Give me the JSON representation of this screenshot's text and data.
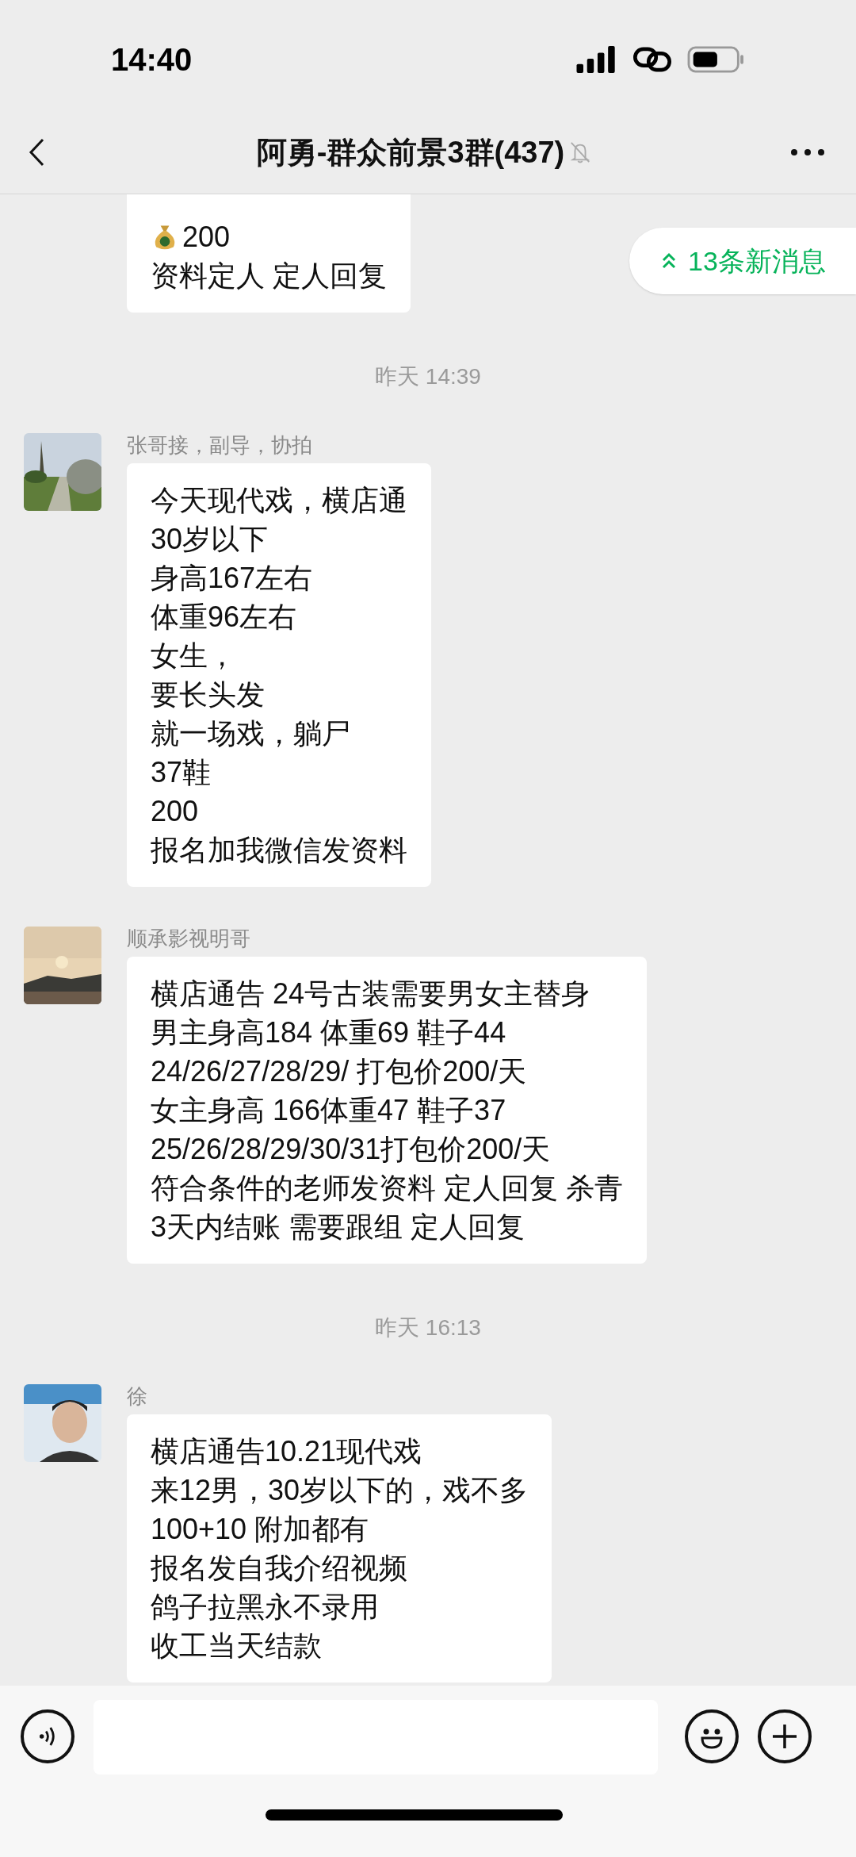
{
  "status_bar": {
    "time": "14:40"
  },
  "header": {
    "title": "阿勇-群众前景3群(437)",
    "muted": true
  },
  "new_messages": {
    "label": "13条新消息"
  },
  "feed": [
    {
      "kind": "message",
      "lines": [
        {
          "kind": "money",
          "text": "200"
        },
        {
          "kind": "text",
          "text": "资料定人  定人回复"
        }
      ]
    },
    {
      "kind": "timestamp",
      "text": "昨天 14:39"
    },
    {
      "kind": "message",
      "sender": "张哥接，副导，协拍",
      "lines": [
        {
          "kind": "text",
          "text": "今天现代戏，横店通"
        },
        {
          "kind": "text",
          "text": "30岁以下"
        },
        {
          "kind": "text",
          "text": "身高167左右"
        },
        {
          "kind": "text",
          "text": "体重96左右"
        },
        {
          "kind": "text",
          "text": "女生，"
        },
        {
          "kind": "text",
          "text": "要长头发"
        },
        {
          "kind": "text",
          "text": "就一场戏，躺尸"
        },
        {
          "kind": "text",
          "text": "37鞋"
        },
        {
          "kind": "text",
          "text": "200"
        },
        {
          "kind": "text",
          "text": "报名加我微信发资料"
        }
      ]
    },
    {
      "kind": "message",
      "sender": "顺承影视明哥",
      "lines": [
        {
          "kind": "text",
          "text": "横店通告 24号古装需要男女主替身"
        },
        {
          "kind": "text",
          "text": "男主身高184 体重69  鞋子44"
        },
        {
          "kind": "text",
          "text": "24/26/27/28/29/ 打包价200/天"
        },
        {
          "kind": "text",
          "text": "女主身高 166体重47  鞋子37"
        },
        {
          "kind": "text",
          "text": "25/26/28/29/30/31打包价200/天"
        },
        {
          "kind": "text",
          "text": "符合条件的老师发资料 定人回复 杀青"
        },
        {
          "kind": "text",
          "text": "3天内结账 需要跟组  定人回复"
        }
      ]
    },
    {
      "kind": "timestamp",
      "text": "昨天 16:13"
    },
    {
      "kind": "message",
      "sender": "徐",
      "lines": [
        {
          "kind": "text",
          "text": "横店通告10.21现代戏"
        },
        {
          "kind": "text",
          "text": "来12男，30岁以下的，戏不多"
        },
        {
          "kind": "text",
          "text": "100+10 附加都有"
        },
        {
          "kind": "text",
          "text": "报名发自我介绍视频"
        },
        {
          "kind": "text",
          "text": "鸽子拉黑永不录用"
        },
        {
          "kind": "text",
          "text": "收工当天结款"
        }
      ]
    }
  ]
}
